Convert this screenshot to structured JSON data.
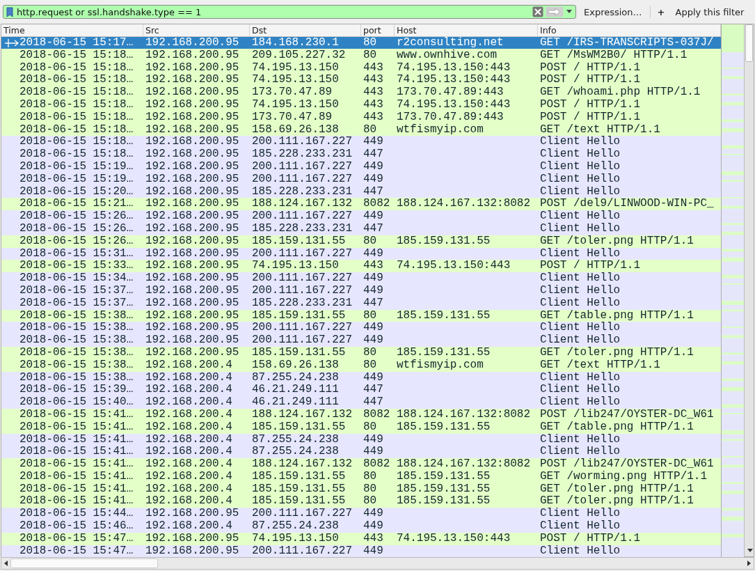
{
  "filter_bar": {
    "value": "http.request or ssl.handshake.type == 1",
    "expression_button": "Expression…",
    "add_button": "+",
    "apply_button": "Apply this filter"
  },
  "columns": [
    "Time",
    "Src",
    "Dst",
    "port",
    "Host",
    "Info"
  ],
  "rows": [
    {
      "kind": "http",
      "selected": true,
      "time": "2018-06-15 15:17…",
      "src": "192.168.200.95",
      "dst": "184.168.230.1",
      "port": "80",
      "host": "r2consulting.net",
      "info": "GET /IRS-TRANSCRIPTS-037J/"
    },
    {
      "kind": "http",
      "selected": false,
      "time": "2018-06-15 15:18…",
      "src": "192.168.200.95",
      "dst": "209.105.227.32",
      "port": "80",
      "host": "www.ownhive.com",
      "info": "GET /MsWM2B0/ HTTP/1.1"
    },
    {
      "kind": "http",
      "selected": false,
      "time": "2018-06-15 15:18…",
      "src": "192.168.200.95",
      "dst": "74.195.13.150",
      "port": "443",
      "host": "74.195.13.150:443",
      "info": "POST / HTTP/1.1"
    },
    {
      "kind": "http",
      "selected": false,
      "time": "2018-06-15 15:18…",
      "src": "192.168.200.95",
      "dst": "74.195.13.150",
      "port": "443",
      "host": "74.195.13.150:443",
      "info": "POST / HTTP/1.1"
    },
    {
      "kind": "http",
      "selected": false,
      "time": "2018-06-15 15:18…",
      "src": "192.168.200.95",
      "dst": "173.70.47.89",
      "port": "443",
      "host": "173.70.47.89:443",
      "info": "GET /whoami.php HTTP/1.1"
    },
    {
      "kind": "http",
      "selected": false,
      "time": "2018-06-15 15:18…",
      "src": "192.168.200.95",
      "dst": "74.195.13.150",
      "port": "443",
      "host": "74.195.13.150:443",
      "info": "POST / HTTP/1.1"
    },
    {
      "kind": "http",
      "selected": false,
      "time": "2018-06-15 15:18…",
      "src": "192.168.200.95",
      "dst": "173.70.47.89",
      "port": "443",
      "host": "173.70.47.89:443",
      "info": "POST / HTTP/1.1"
    },
    {
      "kind": "http",
      "selected": false,
      "time": "2018-06-15 15:18…",
      "src": "192.168.200.95",
      "dst": "158.69.26.138",
      "port": "80",
      "host": "wtfismyip.com",
      "info": "GET /text HTTP/1.1"
    },
    {
      "kind": "tls",
      "selected": false,
      "time": "2018-06-15 15:18…",
      "src": "192.168.200.95",
      "dst": "200.111.167.227",
      "port": "449",
      "info": "Client Hello"
    },
    {
      "kind": "tls",
      "selected": false,
      "time": "2018-06-15 15:18…",
      "src": "192.168.200.95",
      "dst": "185.228.233.231",
      "port": "447",
      "info": "Client Hello"
    },
    {
      "kind": "tls",
      "selected": false,
      "time": "2018-06-15 15:19…",
      "src": "192.168.200.95",
      "dst": "200.111.167.227",
      "port": "449",
      "info": "Client Hello"
    },
    {
      "kind": "tls",
      "selected": false,
      "time": "2018-06-15 15:19…",
      "src": "192.168.200.95",
      "dst": "200.111.167.227",
      "port": "449",
      "info": "Client Hello"
    },
    {
      "kind": "tls",
      "selected": false,
      "time": "2018-06-15 15:20…",
      "src": "192.168.200.95",
      "dst": "185.228.233.231",
      "port": "447",
      "info": "Client Hello"
    },
    {
      "kind": "http",
      "selected": false,
      "time": "2018-06-15 15:21…",
      "src": "192.168.200.95",
      "dst": "188.124.167.132",
      "port": "8082",
      "host": "188.124.167.132:8082",
      "info": "POST /del9/LINWOOD-WIN-PC_"
    },
    {
      "kind": "tls",
      "selected": false,
      "time": "2018-06-15 15:26…",
      "src": "192.168.200.95",
      "dst": "200.111.167.227",
      "port": "449",
      "info": "Client Hello"
    },
    {
      "kind": "tls",
      "selected": false,
      "time": "2018-06-15 15:26…",
      "src": "192.168.200.95",
      "dst": "185.228.233.231",
      "port": "447",
      "info": "Client Hello"
    },
    {
      "kind": "http",
      "selected": false,
      "time": "2018-06-15 15:26…",
      "src": "192.168.200.95",
      "dst": "185.159.131.55",
      "port": "80",
      "host": "185.159.131.55",
      "info": "GET /toler.png HTTP/1.1"
    },
    {
      "kind": "tls",
      "selected": false,
      "time": "2018-06-15 15:31…",
      "src": "192.168.200.95",
      "dst": "200.111.167.227",
      "port": "449",
      "info": "Client Hello"
    },
    {
      "kind": "http",
      "selected": false,
      "time": "2018-06-15 15:33…",
      "src": "192.168.200.95",
      "dst": "74.195.13.150",
      "port": "443",
      "host": "74.195.13.150:443",
      "info": "POST / HTTP/1.1"
    },
    {
      "kind": "tls",
      "selected": false,
      "time": "2018-06-15 15:34…",
      "src": "192.168.200.95",
      "dst": "200.111.167.227",
      "port": "449",
      "info": "Client Hello"
    },
    {
      "kind": "tls",
      "selected": false,
      "time": "2018-06-15 15:37…",
      "src": "192.168.200.95",
      "dst": "200.111.167.227",
      "port": "449",
      "info": "Client Hello"
    },
    {
      "kind": "tls",
      "selected": false,
      "time": "2018-06-15 15:37…",
      "src": "192.168.200.95",
      "dst": "185.228.233.231",
      "port": "447",
      "info": "Client Hello"
    },
    {
      "kind": "http",
      "selected": false,
      "time": "2018-06-15 15:38…",
      "src": "192.168.200.95",
      "dst": "185.159.131.55",
      "port": "80",
      "host": "185.159.131.55",
      "info": "GET /table.png HTTP/1.1"
    },
    {
      "kind": "tls",
      "selected": false,
      "time": "2018-06-15 15:38…",
      "src": "192.168.200.95",
      "dst": "200.111.167.227",
      "port": "449",
      "info": "Client Hello"
    },
    {
      "kind": "tls",
      "selected": false,
      "time": "2018-06-15 15:38…",
      "src": "192.168.200.95",
      "dst": "200.111.167.227",
      "port": "449",
      "info": "Client Hello"
    },
    {
      "kind": "http",
      "selected": false,
      "time": "2018-06-15 15:38…",
      "src": "192.168.200.95",
      "dst": "185.159.131.55",
      "port": "80",
      "host": "185.159.131.55",
      "info": "GET /toler.png HTTP/1.1"
    },
    {
      "kind": "http",
      "selected": false,
      "time": "2018-06-15 15:38…",
      "src": "192.168.200.4",
      "dst": "158.69.26.138",
      "port": "80",
      "host": "wtfismyip.com",
      "info": "GET /text HTTP/1.1"
    },
    {
      "kind": "tls",
      "selected": false,
      "time": "2018-06-15 15:38…",
      "src": "192.168.200.4",
      "dst": "87.255.24.238",
      "port": "449",
      "info": "Client Hello"
    },
    {
      "kind": "tls",
      "selected": false,
      "time": "2018-06-15 15:39…",
      "src": "192.168.200.4",
      "dst": "46.21.249.111",
      "port": "447",
      "info": "Client Hello"
    },
    {
      "kind": "tls",
      "selected": false,
      "time": "2018-06-15 15:40…",
      "src": "192.168.200.4",
      "dst": "46.21.249.111",
      "port": "447",
      "info": "Client Hello"
    },
    {
      "kind": "http",
      "selected": false,
      "time": "2018-06-15 15:41…",
      "src": "192.168.200.4",
      "dst": "188.124.167.132",
      "port": "8082",
      "host": "188.124.167.132:8082",
      "info": "POST /lib247/OYSTER-DC_W61"
    },
    {
      "kind": "http",
      "selected": false,
      "time": "2018-06-15 15:41…",
      "src": "192.168.200.4",
      "dst": "185.159.131.55",
      "port": "80",
      "host": "185.159.131.55",
      "info": "GET /table.png HTTP/1.1"
    },
    {
      "kind": "tls",
      "selected": false,
      "time": "2018-06-15 15:41…",
      "src": "192.168.200.4",
      "dst": "87.255.24.238",
      "port": "449",
      "info": "Client Hello"
    },
    {
      "kind": "tls",
      "selected": false,
      "time": "2018-06-15 15:41…",
      "src": "192.168.200.4",
      "dst": "87.255.24.238",
      "port": "449",
      "info": "Client Hello"
    },
    {
      "kind": "http",
      "selected": false,
      "time": "2018-06-15 15:41…",
      "src": "192.168.200.4",
      "dst": "188.124.167.132",
      "port": "8082",
      "host": "188.124.167.132:8082",
      "info": "POST /lib247/OYSTER-DC_W61"
    },
    {
      "kind": "http",
      "selected": false,
      "time": "2018-06-15 15:41…",
      "src": "192.168.200.4",
      "dst": "185.159.131.55",
      "port": "80",
      "host": "185.159.131.55",
      "info": "GET /worming.png HTTP/1.1"
    },
    {
      "kind": "http",
      "selected": false,
      "time": "2018-06-15 15:41…",
      "src": "192.168.200.4",
      "dst": "185.159.131.55",
      "port": "80",
      "host": "185.159.131.55",
      "info": "GET /toler.png HTTP/1.1"
    },
    {
      "kind": "http",
      "selected": false,
      "time": "2018-06-15 15:41…",
      "src": "192.168.200.4",
      "dst": "185.159.131.55",
      "port": "80",
      "host": "185.159.131.55",
      "info": "GET /toler.png HTTP/1.1"
    },
    {
      "kind": "tls",
      "selected": false,
      "time": "2018-06-15 15:44…",
      "src": "192.168.200.95",
      "dst": "200.111.167.227",
      "port": "449",
      "info": "Client Hello"
    },
    {
      "kind": "tls",
      "selected": false,
      "time": "2018-06-15 15:46…",
      "src": "192.168.200.4",
      "dst": "87.255.24.238",
      "port": "449",
      "info": "Client Hello"
    },
    {
      "kind": "http",
      "selected": false,
      "time": "2018-06-15 15:47…",
      "src": "192.168.200.95",
      "dst": "74.195.13.150",
      "port": "443",
      "host": "74.195.13.150:443",
      "info": "POST / HTTP/1.1"
    },
    {
      "kind": "tls",
      "selected": false,
      "time": "2018-06-15 15:47…",
      "src": "192.168.200.95",
      "dst": "200.111.167.227",
      "port": "449",
      "info": "Client Hello"
    }
  ]
}
